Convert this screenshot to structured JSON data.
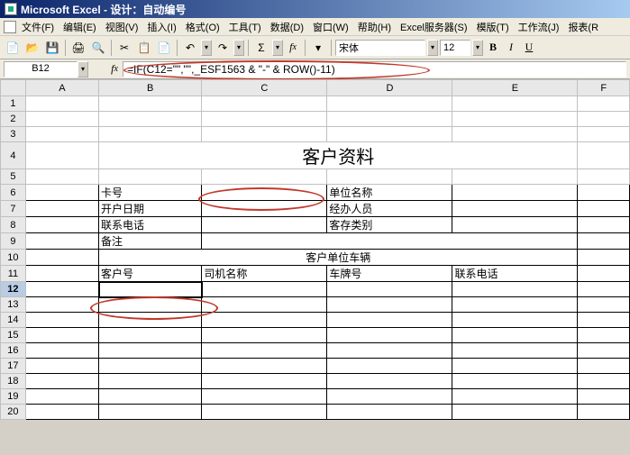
{
  "titlebar": {
    "appname": "Microsoft Excel - 设计：自动编号"
  },
  "menubar": {
    "file": "文件(F)",
    "edit": "编辑(E)",
    "view": "视图(V)",
    "insert": "插入(I)",
    "format": "格式(O)",
    "tools": "工具(T)",
    "data": "数据(D)",
    "window": "窗口(W)",
    "help": "帮助(H)",
    "excelserver": "Excel服务器(S)",
    "template": "模版(T)",
    "workflow": "工作流(J)",
    "report": "报表(R"
  },
  "toolbar": {
    "font": "宋体",
    "size": "12",
    "bold": "B",
    "italic": "I",
    "underline": "U"
  },
  "formula": {
    "cellref": "B12",
    "content": "=IF(C12=\"\",\"\",_ESF1563 & \"-\" & ROW()-11)"
  },
  "cols": [
    "A",
    "B",
    "C",
    "D",
    "E",
    "F"
  ],
  "rows": {
    "r4_title": "客户资料",
    "r6b": "卡号",
    "r6d": "单位名称",
    "r7b": "开户日期",
    "r7d": "经办人员",
    "r8b": "联系电话",
    "r8d": "客存类别",
    "r9b": "备注",
    "r10_title": "客户单位车辆",
    "r11b": "客户号",
    "r11c": "司机名称",
    "r11d": "车牌号",
    "r11e": "联系电话"
  }
}
